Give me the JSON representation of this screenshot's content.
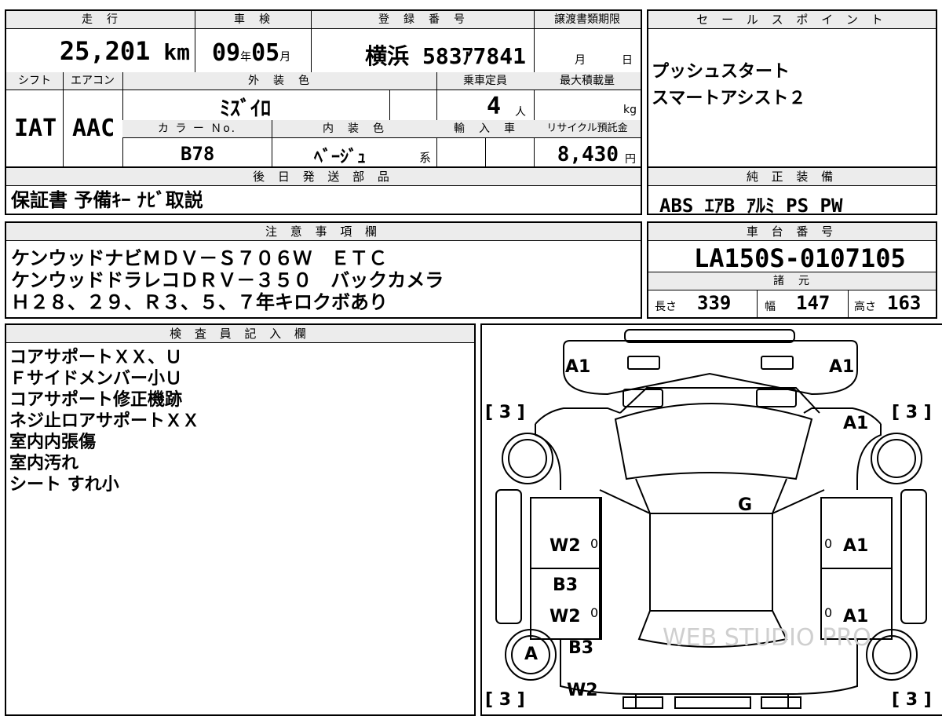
{
  "top": {
    "mileage_label": "走　行",
    "mileage_value": "25,201",
    "mileage_unit": "km",
    "inspection_label": "車　検",
    "inspection_year": "09",
    "inspection_year_unit": "年",
    "inspection_month": "05",
    "inspection_month_unit": "月",
    "registration_label": "登　録　番　号",
    "registration_value": "横浜 583ｱ7841",
    "transfer_label": "譲渡書類期限",
    "transfer_month": "月",
    "transfer_day": "日",
    "sales_point_label": "セ ー ル ス ポ イ ン ト",
    "sales_points": [
      "プッシュスタート",
      "スマートアシスト２"
    ]
  },
  "row2": {
    "shift_label": "シフト",
    "shift_value": "IAT",
    "ac_label": "エアコン",
    "ac_value": "AAC",
    "exterior_label": "外　装　色",
    "exterior_value": "ﾐｽﾞｲﾛ",
    "capacity_label": "乗車定員",
    "capacity_value": "4",
    "capacity_unit": "人",
    "max_load_label": "最大積載量",
    "max_load_unit": "kg",
    "color_no_label": "カ ラ ー Ｎo.",
    "color_no_value": "B78",
    "interior_label": "内　装　色",
    "interior_value": "ﾍﾞｰｼﾞｭ",
    "interior_suffix": "系",
    "import_label": "輸　入　車",
    "recycle_label": "リサイクル預託金",
    "recycle_value": "8,430",
    "recycle_unit": "円"
  },
  "later_parts": {
    "label": "後 日 発 送 部 品",
    "value": "保証書 予備ｷｰ ﾅﾋﾞ取説"
  },
  "equipment": {
    "label": "純 正 装 備",
    "value": "ABS ｴｱB ｱﾙﾐ PS PW"
  },
  "notes": {
    "label": "注 意 事 項 欄",
    "lines": [
      "ケンウッドナビＭＤＶ－Ｓ７０６Ｗ　ＥＴＣ",
      "ケンウッドドラレコＤＲＶ－３５０　バックカメラ",
      "Ｈ２８、２９、Ｒ３、５、７年キロクボあり"
    ]
  },
  "chassis": {
    "label": "車 台 番 号",
    "value": "LA150S-0107105",
    "spec_label": "諸　元",
    "length_label": "長さ",
    "length_value": "339",
    "width_label": "幅",
    "width_value": "147",
    "height_label": "高さ",
    "height_value": "163"
  },
  "inspector": {
    "label": "検 査 員 記 入 欄",
    "lines": [
      "コアサポートＸＸ、Ｕ",
      "Ｆサイドメンバー小Ｕ",
      "コアサポート修正機跡",
      "ネジ止ロアサポートＸＸ",
      "室内内張傷",
      "室内汚れ",
      "シート すれ小"
    ]
  },
  "diagram": {
    "marks": {
      "front_left": "A1",
      "front_right": "A1",
      "fender_right": "A1",
      "glass": "G",
      "door_fl": "W2",
      "door_fr": "A1",
      "door_rl_b": "B3",
      "door_rl_w": "W2",
      "door_rr": "A1",
      "wheel_rl": "A",
      "quarter_l_b": "B3",
      "quarter_l_w": "W2",
      "tire_fl": "[ 3 ]",
      "tire_fr": "[ 3 ]",
      "tire_rl": "[ 3 ]",
      "tire_rr": "[ 3 ]",
      "zero_1": "0",
      "zero_2": "0",
      "zero_3": "0",
      "zero_4": "0"
    },
    "watermark": "WEB STUDIO PRO"
  }
}
